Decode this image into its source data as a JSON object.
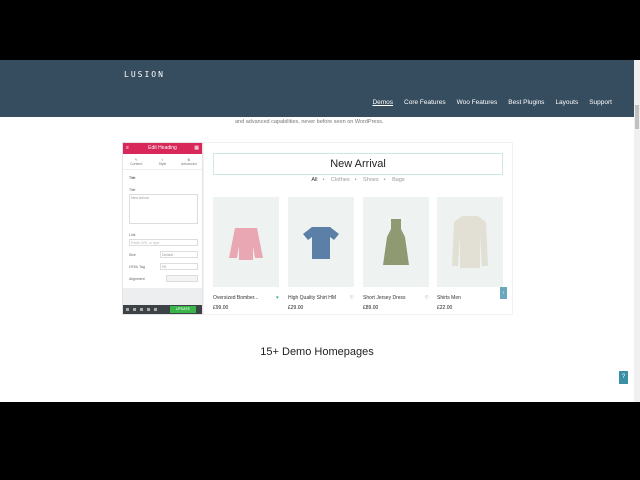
{
  "header": {
    "logo": "LUSION",
    "nav": [
      "Demos",
      "Core Features",
      "Woo Features",
      "Best Plugins",
      "Layouts",
      "Support"
    ]
  },
  "intro": "and advanced capabilities, never before seen on WordPress.",
  "editor": {
    "title": "Edit Heading",
    "tabs": [
      "Content",
      "Style",
      "Advanced"
    ],
    "section": "Title",
    "title_label": "Title",
    "title_value": "New Arrival",
    "link_label": "Link",
    "link_placeholder": "Paste URL or type",
    "size_label": "Size",
    "size_value": "Default",
    "tag_label": "HTML Tag",
    "tag_value": "H2",
    "align_label": "Alignment",
    "update": "UPDATE"
  },
  "preview": {
    "heading": "New Arrival",
    "filters": [
      "All",
      "Clothes",
      "Shoes",
      "Bags"
    ],
    "products": [
      {
        "name": "Oversized Bomber...",
        "price": "£99.00",
        "color": "#e9a6b3"
      },
      {
        "name": "High Quality Shirt HM",
        "price": "£29.00",
        "color": "#5b7fa6"
      },
      {
        "name": "Short Jersey Dress",
        "price": "£89.00",
        "color": "#8f9a72"
      },
      {
        "name": "Shirts Men",
        "price": "£22.00",
        "color": "#e2e0d4"
      }
    ]
  },
  "section_title": "15+ Demo Homepages",
  "help": "?"
}
